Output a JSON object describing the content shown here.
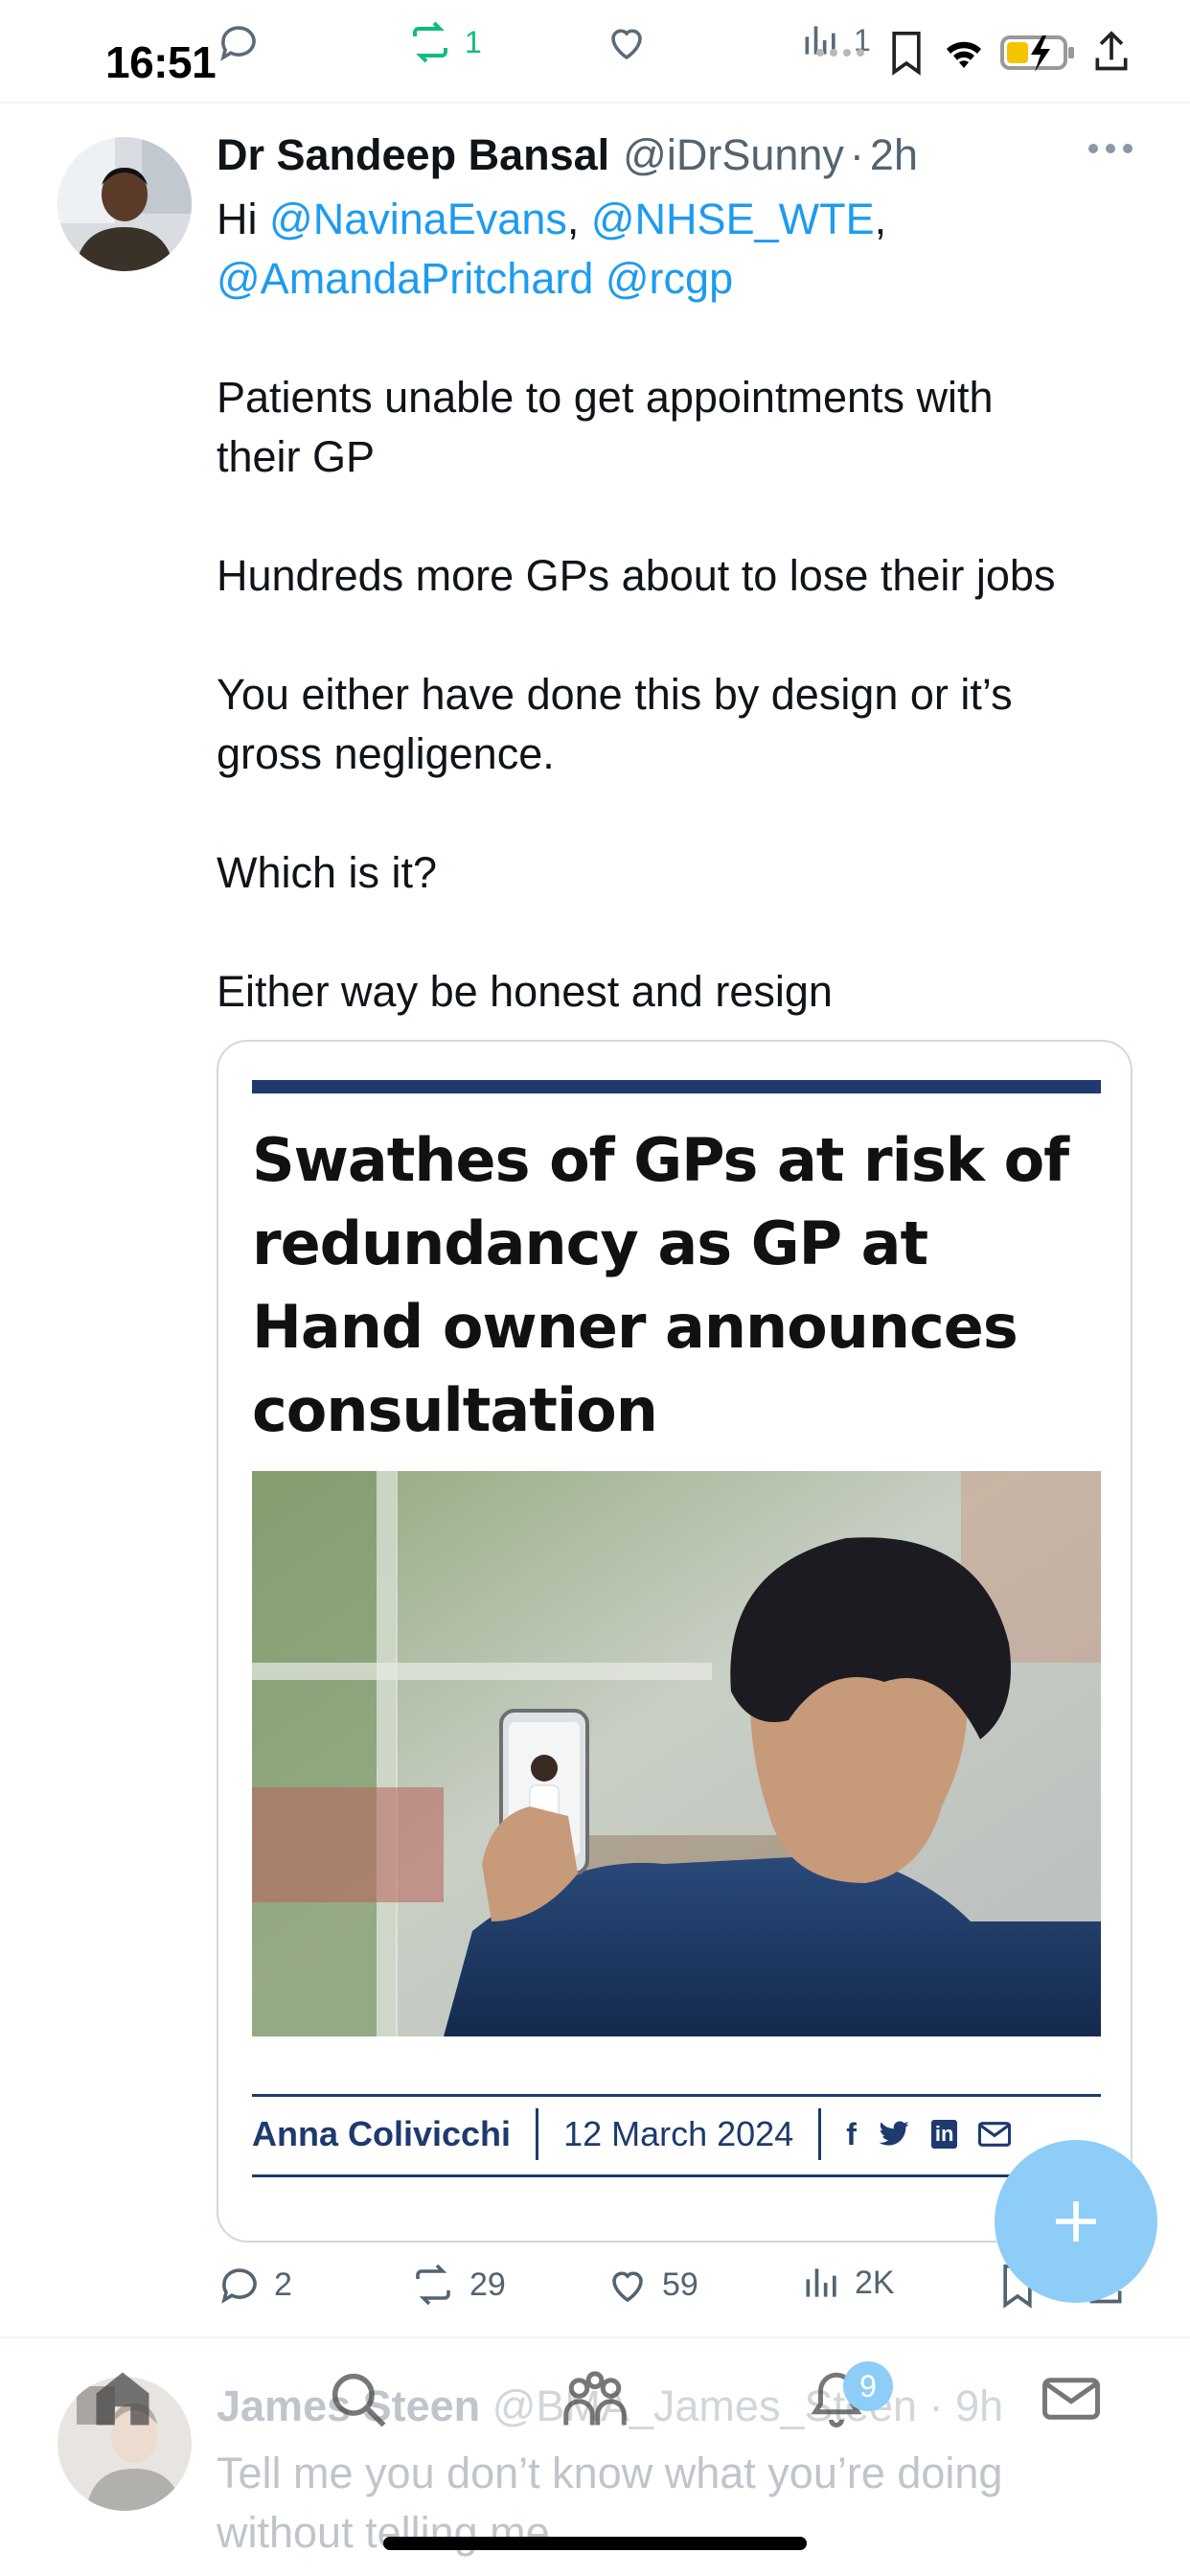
{
  "status_bar": {
    "time": "16:51"
  },
  "prev_tweet_actions": {
    "retweets": "1",
    "views": "1"
  },
  "tweet": {
    "author_name": "Dr Sandeep Bansal",
    "handle": "@iDrSunny",
    "separator": "·",
    "time": "2h",
    "body": {
      "greeting": "Hi",
      "mention1": "@NavinaEvans",
      "comma1": ",",
      "mention2": "@NHSE_WTE",
      "comma2": ",",
      "mention3": "@AmandaPritchard",
      "mention4": "@rcgp",
      "para1": "Patients unable to get appointments with their GP",
      "para2": "Hundreds more GPs about to lose their jobs",
      "para3": "You either have done this by design or it’s gross negligence.",
      "para4": "Which is it?",
      "para5": "Either way be honest and resign"
    },
    "card": {
      "headline": "Swathes of GPs at risk of redundancy as GP at Hand owner announces consultation",
      "byline_author": "Anna Colivicchi",
      "byline_date": "12 March 2024",
      "social": [
        "f",
        "in"
      ]
    },
    "actions": {
      "replies": "2",
      "retweets": "29",
      "likes": "59",
      "views": "2K"
    }
  },
  "next_tweet": {
    "author_name": "James Steen",
    "handle": "@BMA_James_Steen",
    "separator": "·",
    "time": "9h",
    "text": "Tell me you don’t know what you’re doing without telling me"
  },
  "nav": {
    "notifications_badge": "9"
  },
  "colors": {
    "accent": "#1d9bf0",
    "retweet_green": "#00ba7c",
    "fab": "#8ecdf8",
    "card_navy": "#1e3a6e"
  }
}
